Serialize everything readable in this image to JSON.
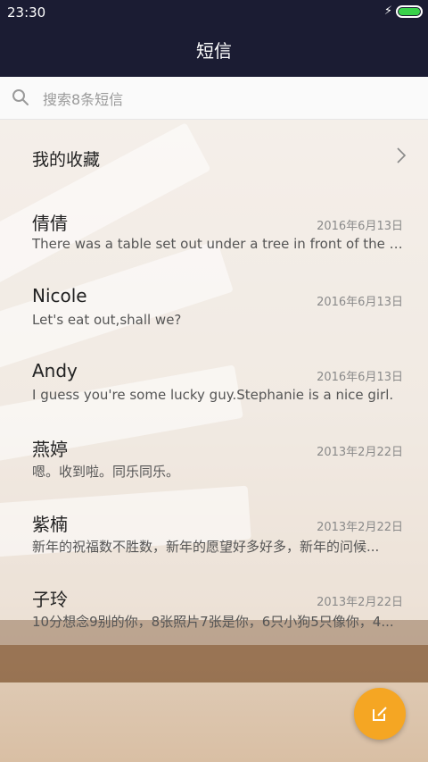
{
  "status": {
    "time": "23:30"
  },
  "header": {
    "title": "短信"
  },
  "search": {
    "placeholder": "搜索8条短信"
  },
  "favorites": {
    "label": "我的收藏"
  },
  "messages": [
    {
      "name": "倩倩",
      "date": "2016年6月13日",
      "preview": "There was a table set out under a tree in front of the ho..."
    },
    {
      "name": "Nicole",
      "date": "2016年6月13日",
      "preview": "Let's eat out,shall we?"
    },
    {
      "name": "Andy",
      "date": "2016年6月13日",
      "preview": "I guess you're some lucky guy.Stephanie is a nice girl."
    },
    {
      "name": "燕婷",
      "date": "2013年2月22日",
      "preview": "嗯。收到啦。同乐同乐。"
    },
    {
      "name": "紫楠",
      "date": "2013年2月22日",
      "preview": "新年的祝福数不胜数，新年的愿望好多好多，新年的问候..."
    },
    {
      "name": "子玲",
      "date": "2013年2月22日",
      "preview": "10分想念9别的你，8张照片7张是你，6只小狗5只像你，4..."
    }
  ],
  "colors": {
    "header_bg": "#1b1c33",
    "fab": "#f5a623",
    "battery": "#39d24a"
  },
  "icons": {
    "search": "search-icon",
    "chevron": "chevron-right-icon",
    "compose": "compose-icon",
    "charging": "charging-icon",
    "battery": "battery-icon"
  }
}
